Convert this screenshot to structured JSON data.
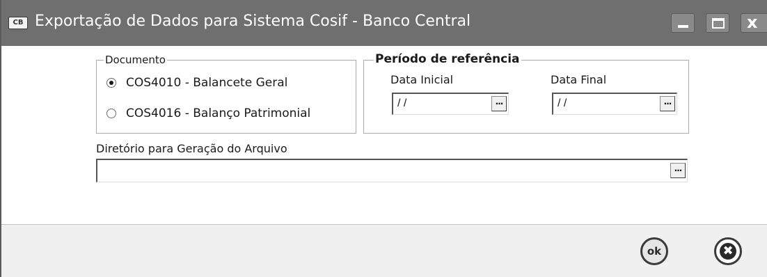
{
  "window": {
    "icon_text": "CB",
    "title": "Exportação de Dados para Sistema Cosif - Banco Central",
    "minimize_icon": "minimize-icon",
    "maximize_icon": "maximize-icon",
    "close_icon": "close-icon",
    "close_glyph": "x"
  },
  "documento": {
    "legend": "Documento",
    "options": [
      {
        "label": "COS4010 - Balancete Geral",
        "checked": true
      },
      {
        "label": "COS4016 - Balanço Patrimonial",
        "checked": false
      }
    ]
  },
  "periodo": {
    "legend": "Período de referência",
    "data_inicial": {
      "label": "Data Inicial",
      "value": "/ /",
      "browse": "..."
    },
    "data_final": {
      "label": "Data Final",
      "value": "/ /",
      "browse": "..."
    }
  },
  "diretorio": {
    "label": "Diretório para Geração do Arquivo",
    "value": "",
    "browse": "..."
  },
  "footer": {
    "ok_label": "ok",
    "cancel_glyph": "✖"
  }
}
